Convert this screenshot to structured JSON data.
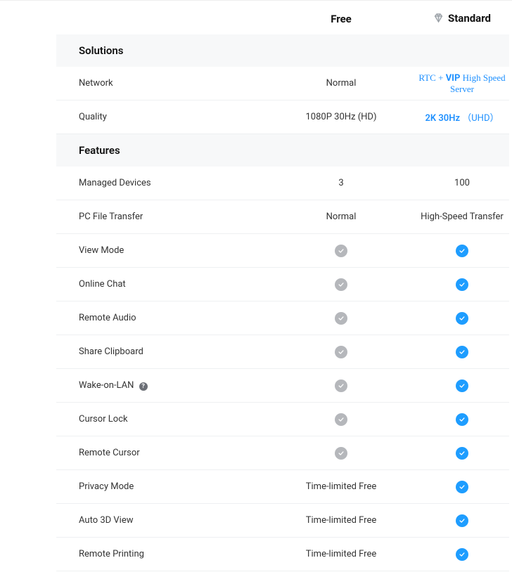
{
  "header": {
    "free": "Free",
    "standard": "Standard"
  },
  "sections": {
    "solutions": "Solutions",
    "features": "Features"
  },
  "rows": {
    "network": {
      "label": "Network",
      "free": "Normal",
      "std_prefix": "RTC + ",
      "std_bold": "VIP",
      "std_suffix": " High Speed Server"
    },
    "quality": {
      "label": "Quality",
      "free": "1080P 30Hz (HD)",
      "std_main": "2K 30Hz",
      "std_paren": "（UHD）"
    },
    "managed": {
      "label": "Managed Devices",
      "free": "3",
      "std": "100"
    },
    "transfer": {
      "label": "PC File Transfer",
      "free": "Normal",
      "std": "High-Speed Transfer"
    },
    "viewmode": {
      "label": "View Mode"
    },
    "chat": {
      "label": "Online Chat"
    },
    "audio": {
      "label": "Remote Audio"
    },
    "clipboard": {
      "label": "Share Clipboard"
    },
    "wol": {
      "label": "Wake-on-LAN"
    },
    "cursorlock": {
      "label": "Cursor Lock"
    },
    "remotecursor": {
      "label": "Remote Cursor"
    },
    "privacy": {
      "label": "Privacy Mode",
      "free": "Time-limited Free"
    },
    "auto3d": {
      "label": "Auto 3D View",
      "free": "Time-limited Free"
    },
    "printing": {
      "label": "Remote Printing",
      "free": "Time-limited Free"
    }
  },
  "info_glyph": "?"
}
